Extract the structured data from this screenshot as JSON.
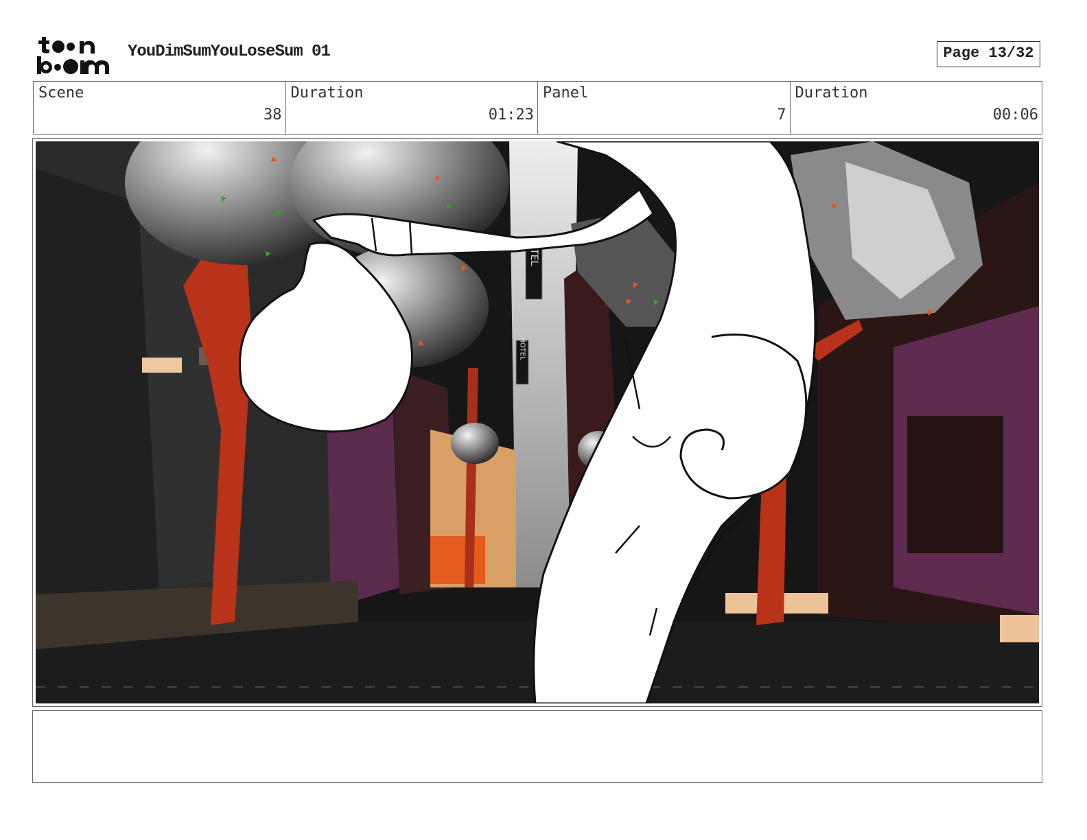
{
  "header": {
    "logo_icon": "toon-boom-logo",
    "project_title": "YouDimSumYouLoseSum 01",
    "page_label": "Page 13/32"
  },
  "info": {
    "scene_label": "Scene",
    "scene_value": "38",
    "scene_duration_label": "Duration",
    "scene_duration_value": "01:23",
    "panel_label": "Panel",
    "panel_value": "7",
    "panel_duration_label": "Duration",
    "panel_duration_value": "00:06"
  },
  "panel": {
    "image_icon": "storyboard-panel-image",
    "sign_top": "HOTEL",
    "sign_bottom": "HOTEL"
  },
  "notes": {
    "text": ""
  },
  "colors": {
    "tree_red": "#b8331a",
    "wall_purple": "#5e2a4f",
    "sky_gray": "#a8a8a8",
    "orange_accent": "#e8561c",
    "dark": "#151515"
  }
}
